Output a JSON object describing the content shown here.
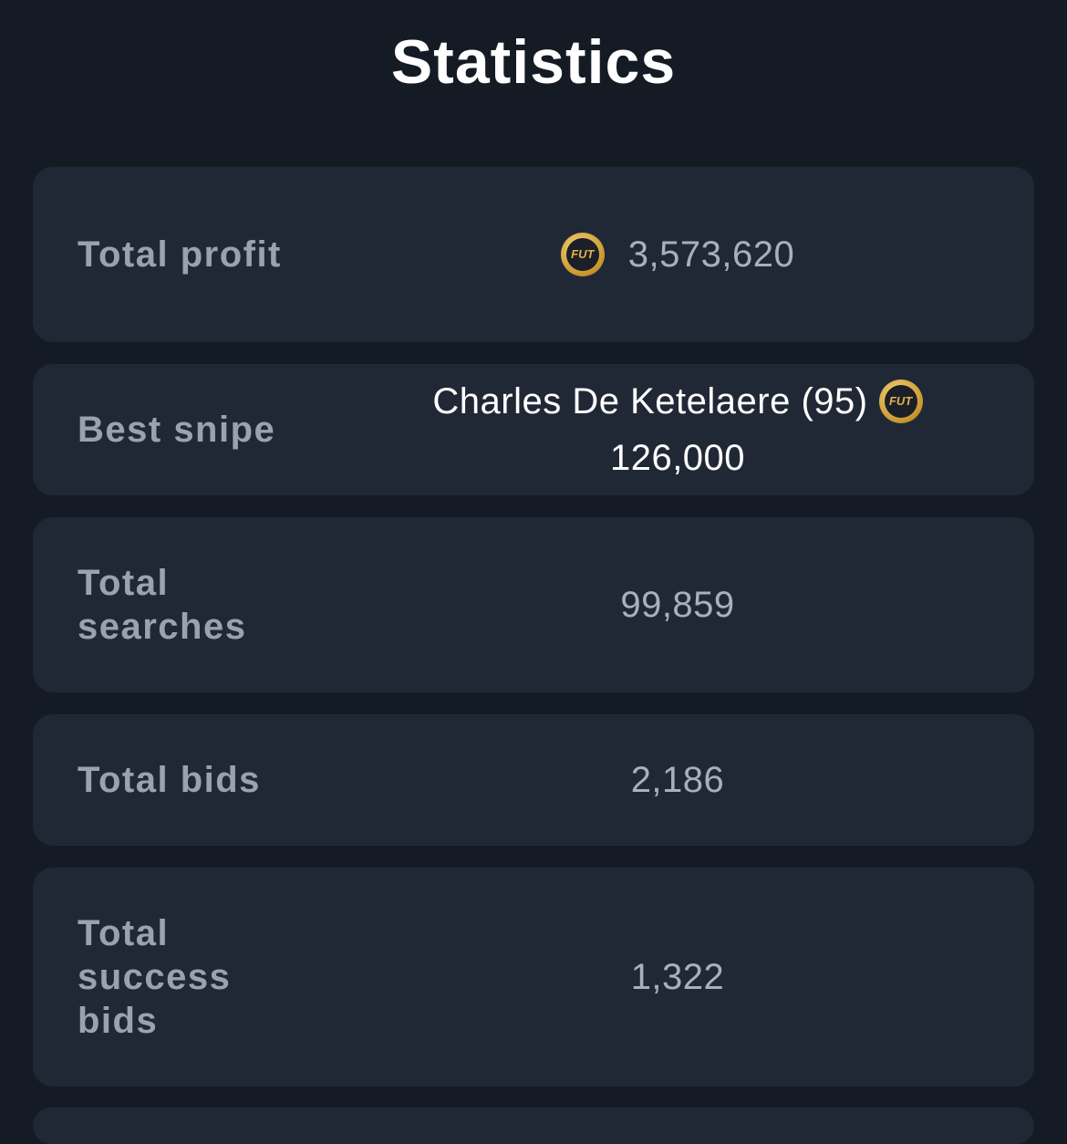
{
  "header": {
    "title": "Statistics"
  },
  "coin": {
    "text": "FUT"
  },
  "stats": [
    {
      "label": "Total profit",
      "value": "3,573,620"
    },
    {
      "label": "Best snipe",
      "player": "Charles De Ketelaere (95)",
      "value": "126,000"
    },
    {
      "label": "Total searches",
      "value": "99,859"
    },
    {
      "label": "Total bids",
      "value": "2,186"
    },
    {
      "label": "Total success bids",
      "value": "1,322"
    }
  ]
}
